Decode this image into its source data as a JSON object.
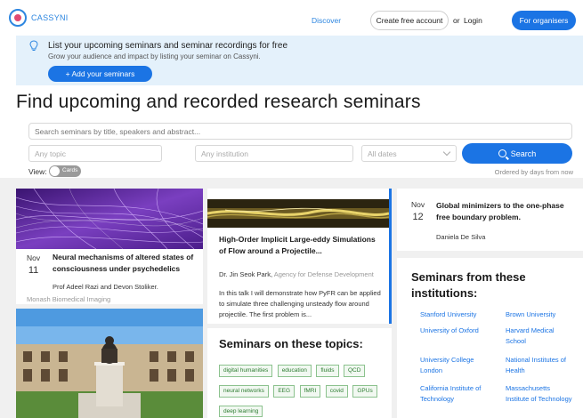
{
  "header": {
    "logo": "CASSYNI",
    "discover": "Discover",
    "create_account": "Create free account",
    "or": "or",
    "login": "Login",
    "organisers": "For organisers"
  },
  "banner": {
    "title": "List your upcoming seminars and seminar recordings for free",
    "subtitle": "Grow your audience and impact by listing your seminar on Cassyni.",
    "add_button": "+ Add your seminars"
  },
  "page_title": "Find upcoming and recorded research seminars",
  "search": {
    "placeholder": "Search seminars by title, speakers and abstract...",
    "topic": "Any topic",
    "institution": "Any institution",
    "dates": "All dates",
    "button": "Search",
    "view_label": "View:",
    "toggle_label": "Cards",
    "ordered": "Ordered by days from now"
  },
  "cards": [
    {
      "month": "Nov",
      "day": "11",
      "title": "Neural mechanisms of altered states of consciousness under psychedelics",
      "speaker": "Prof Adeel Razi and Devon Stoliker.",
      "affiliation": "Monash Biomedical Imaging"
    },
    {
      "title": "High-Order Implicit Large-eddy Simulations of Flow around a Projectile...",
      "speaker": "Dr. Jin Seok Park,",
      "affiliation": "Agency for Defense Development",
      "description": "In this talk I will demonstrate how PyFR can be applied to simulate three challenging unsteady flow around projectile. The first problem is..."
    },
    {
      "month": "Nov",
      "day": "12",
      "title": "Global minimizers to the one-phase free boundary problem.",
      "speaker": "Daniela De Silva"
    }
  ],
  "topics": {
    "title": "Seminars on these topics:",
    "items": [
      "digital humanities",
      "education",
      "fluids",
      "QCD",
      "neural networks",
      "EEG",
      "fMRI",
      "covid",
      "GPUs",
      "deep learning"
    ]
  },
  "institutions": {
    "title": "Seminars from these institutions:",
    "items": [
      "Stanford University",
      "Brown University",
      "University of Oxford",
      "Harvard Medical School",
      "University College London",
      "National Institutes of Health",
      "California Institute of Technology",
      "Massachusetts Institute of Technology"
    ]
  },
  "colors": {
    "accent": "#1b74e4",
    "banner_bg": "#e4f1fb",
    "chip_green": "#2e7d32"
  }
}
